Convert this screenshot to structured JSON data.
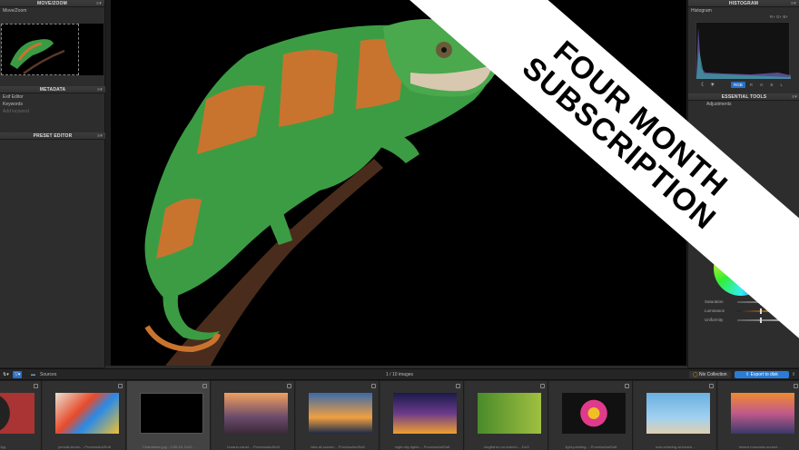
{
  "left": {
    "move_zoom_title": "MOVE/ZOOM",
    "move_zoom_label": "Move/Zoom",
    "metadata_title": "METADATA",
    "exif_label": "Exif Editor",
    "keywords_label": "Keywords",
    "add_keyword_placeholder": "Add keyword",
    "preset_editor_title": "PRESET EDITOR"
  },
  "right": {
    "histogram_title": "HISTOGRAM",
    "histogram_label": "Histogram",
    "histogram_tools": "R+ G+ B+",
    "channels": [
      "RGB",
      "R",
      "G",
      "B",
      "L"
    ],
    "essential_title": "ESSENTIAL TOOLS",
    "color_adjust_label": "Adjustments",
    "sliders": [
      {
        "label": "Saturation",
        "value": 0.5
      },
      {
        "label": "Luminance",
        "value": 0.5
      },
      {
        "label": "Uniformity",
        "value": 0.5
      }
    ]
  },
  "bottom": {
    "sources_label": "Sources",
    "image_count": "1 / 10 images",
    "nix_label": "Nix Collection",
    "export_label": "Export to disk"
  },
  "filmstrip": [
    {
      "caption": "…_Jpg",
      "selected": false
    },
    {
      "caption": "pencils-brush-…ProcessAndSoft",
      "selected": false
    },
    {
      "caption": "Chameleon.jpg - 0:30:18, DxO…",
      "selected": true
    },
    {
      "caption": "burano-canal-…ProcessAndSoft",
      "selected": false
    },
    {
      "caption": "lake-at-sunset-…ProcessAndSoft",
      "selected": false
    },
    {
      "caption": "night-city-lights-…ProcessAndSoft",
      "selected": false
    },
    {
      "caption": "kingfisher-on-branch-…DxO",
      "selected": false
    },
    {
      "caption": "light-painting-…ProcessAndSoft",
      "selected": false
    },
    {
      "caption": "man-relaxing-at-beach…",
      "selected": false
    },
    {
      "caption": "desert-mountain-sunset…",
      "selected": false
    }
  ],
  "banner": {
    "line1": "FOUR MONTH",
    "line2": "SUBSCRIPTION"
  },
  "colors": {
    "accent": "#2a7cd6",
    "banner_bg": "#ffffff",
    "banner_text": "#000000"
  }
}
